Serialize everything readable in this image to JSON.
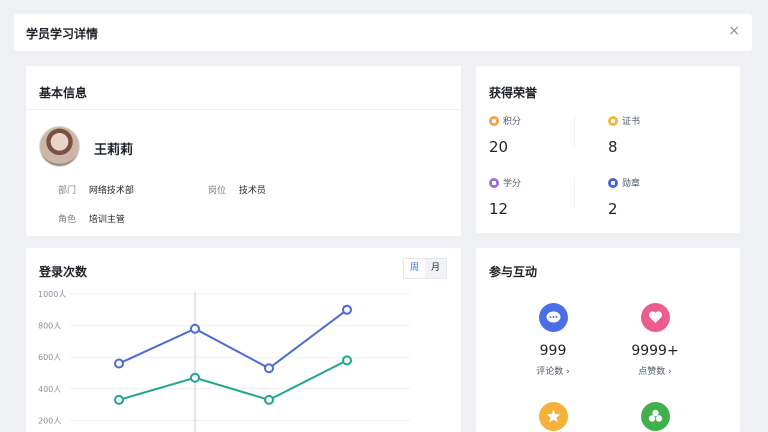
{
  "header": {
    "title": "学员学习详情",
    "close": "×"
  },
  "basic": {
    "title": "基本信息",
    "name": "王莉莉",
    "dept_label": "部门",
    "dept": "网络技术部",
    "post_label": "岗位",
    "post": "技术员",
    "role_label": "角色",
    "role": "培训主管"
  },
  "honors": {
    "title": "获得荣誉",
    "items": [
      {
        "label": "积分",
        "value": "20",
        "color": "#f5a04a"
      },
      {
        "label": "证书",
        "value": "8",
        "color": "#f0b83a"
      },
      {
        "label": "学分",
        "value": "12",
        "color": "#9a6fd0"
      },
      {
        "label": "勋章",
        "value": "2",
        "color": "#4a63d8"
      }
    ]
  },
  "login": {
    "title": "登录次数",
    "tab_week": "周",
    "tab_month": "月",
    "chart_data": {
      "type": "line",
      "y_ticks": [
        "1000人",
        "800人",
        "600人",
        "400人",
        "200人"
      ],
      "ylim": [
        200,
        1000
      ],
      "series": [
        {
          "values": [
            560,
            780,
            530,
            900
          ],
          "color": "#4b6bd6"
        },
        {
          "values": [
            330,
            470,
            330,
            580
          ],
          "color": "#1fa68f"
        }
      ]
    }
  },
  "interact": {
    "title": "参与互动",
    "items": [
      {
        "value": "999",
        "label": "评论数 ›",
        "color": "#4c6ee6",
        "icon": "comment-icon"
      },
      {
        "value": "9999+",
        "label": "点赞数 ›",
        "color": "#ec5d8c",
        "icon": "heart-icon"
      },
      {
        "value": "",
        "label": "",
        "color": "#f4b23c",
        "icon": "star-icon"
      },
      {
        "value": "",
        "label": "",
        "color": "#3fb04a",
        "icon": "clover-icon"
      }
    ]
  }
}
